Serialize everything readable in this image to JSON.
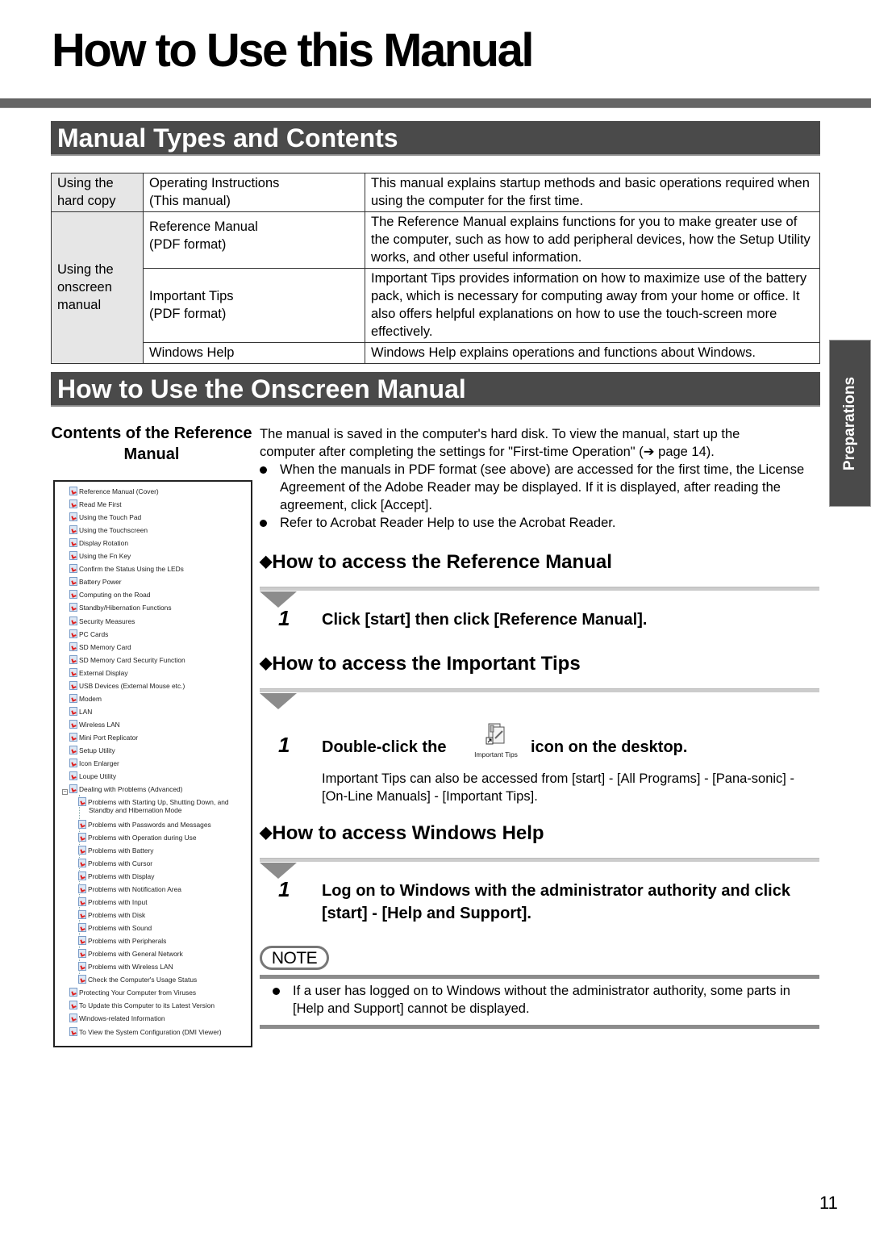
{
  "page": {
    "title": "How to Use this Manual",
    "page_number": "11",
    "side_tab": "Preparations"
  },
  "section1": {
    "heading": "Manual Types and Contents",
    "table": {
      "rows": [
        {
          "category": "Using the hard copy",
          "name": "Operating Instructions\n(This manual)",
          "description": "This manual explains startup methods and basic operations required when using the computer for the first time."
        },
        {
          "category": "Using the onscreen manual",
          "name": "Reference Manual\n(PDF format)",
          "description": "The Reference Manual explains functions for you to make greater use of the computer, such as how to add peripheral devices, how the Setup Utility works, and other useful information."
        },
        {
          "category": "",
          "name": "Important Tips\n(PDF format)",
          "description": "Important Tips provides information on how to maximize use of the battery pack, which is necessary for computing away from your home or office. It also offers helpful explanations on how to use the touch-screen more effectively."
        },
        {
          "category": "",
          "name": "Windows Help",
          "description": "Windows Help explains operations and functions about Windows."
        }
      ]
    }
  },
  "section2": {
    "heading": "How to Use the Onscreen Manual",
    "contents_heading": "Contents of the Reference Manual",
    "tree": {
      "items": [
        "Reference Manual (Cover)",
        "Read Me First",
        "Using the Touch Pad",
        "Using the Touchscreen",
        "Display Rotation",
        "Using the Fn Key",
        "Confirm the Status Using the LEDs",
        "Battery Power",
        "Computing on the Road",
        "Standby/Hibernation Functions",
        "Security Measures",
        "PC Cards",
        "SD Memory Card",
        "SD Memory Card Security Function",
        "External Display",
        "USB Devices (External Mouse etc.)",
        "Modem",
        "LAN",
        "Wireless LAN",
        "Mini Port Replicator",
        "Setup Utility",
        "Icon Enlarger",
        "Loupe Utility",
        "Dealing with Problems (Advanced)"
      ],
      "children": [
        "Problems with Starting Up, Shutting Down, and Standby and Hibernation Mode",
        "Problems with Passwords and Messages",
        "Problems with Operation during Use",
        "Problems with Battery",
        "Problems with Cursor",
        "Problems with Display",
        "Problems with Notification Area",
        "Problems with Input",
        "Problems with Disk",
        "Problems with Sound",
        "Problems with Peripherals",
        "Problems with General Network",
        "Problems with Wireless LAN",
        "Check the Computer's Usage Status"
      ],
      "after": [
        "Protecting Your Computer from Viruses",
        "To Update this Computer to its Latest Version",
        "Windows-related Information",
        "To View the System Configuration (DMI Viewer)"
      ]
    },
    "intro_line1": "The manual is saved in the computer's hard disk.  To view the manual, start up the",
    "intro_line2": "computer after completing the settings for \"First-time Operation\" (➔ page 14).",
    "bullets": [
      "When the manuals in PDF format (see above) are accessed for the first time, the License Agreement of the Adobe Reader may be displayed. If it is displayed, after reading the agreement, click [Accept].",
      "Refer to Acrobat Reader Help to use the Acrobat Reader."
    ],
    "subsections": [
      {
        "heading": "How to access the Reference Manual",
        "step_number": "1",
        "step_text": "Click [start] then click [Reference Manual]."
      },
      {
        "heading": "How to access the Important Tips",
        "step_number": "1",
        "step_text_before": "Double-click the",
        "icon_caption": "Important Tips",
        "step_text_after": "icon on the desktop.",
        "step_note": "Important Tips can also be accessed from [start] - [All Programs] - [Pana-sonic] - [On-Line Manuals] - [Important Tips]."
      },
      {
        "heading": "How to access Windows Help",
        "step_number": "1",
        "step_text": "Log on to Windows with the administrator authority and click [start] - [Help and Support]."
      }
    ],
    "note": {
      "label": "NOTE",
      "text": "If a user has logged on to Windows without the administrator authority, some parts in [Help and Support] cannot be displayed."
    },
    "diamond": "◆"
  }
}
